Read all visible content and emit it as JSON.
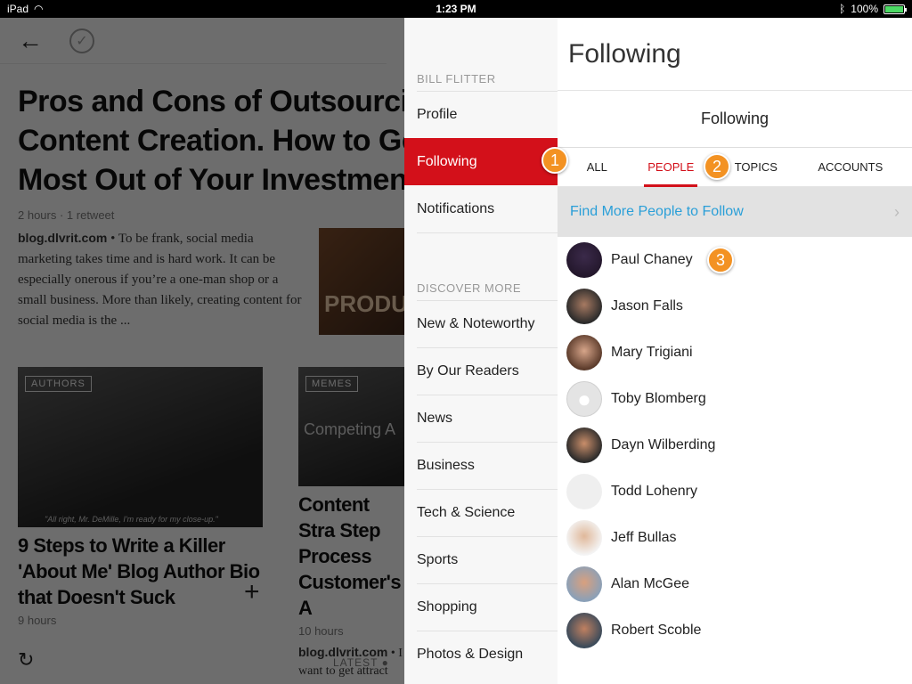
{
  "status_bar": {
    "device": "iPad",
    "time": "1:23 PM",
    "battery": "100%"
  },
  "article": {
    "headline": "Pros and Cons of Outsourcing Content Creation. How to Get the Most Out of Your Investment.",
    "meta": "2 hours · 1 retweet",
    "source": "blog.dlvrit.com",
    "excerpt": " • To be frank, social media marketing takes time and is hard work. It can be especially onerous if you’re a one-man shop or a small business. More than likely, creating content for social media is the ...",
    "thumb_text": "PRODU"
  },
  "cards": [
    {
      "tag": "AUTHORS",
      "caption": "\"All right, Mr. DeMille, I'm ready for my close-up.\"",
      "title": "9 Steps to Write a Killer 'About Me' Blog Author Bio that Doesn't Suck",
      "meta": "9 hours"
    },
    {
      "tag": "MEMES",
      "caption": "Competing A",
      "title": "Content Stra Step Process Customer's A",
      "meta": "10 hours",
      "source": "blog.dlvrit.com",
      "excerpt": " • I",
      "excerpt2": "want to get attract"
    }
  ],
  "bottom": {
    "latest": "LATEST"
  },
  "nav": {
    "user": "BILL FLITTER",
    "items": [
      "Profile",
      "Following",
      "Notifications"
    ],
    "discover_label": "DISCOVER MORE",
    "discover": [
      "New & Noteworthy",
      "By Our Readers",
      "News",
      "Business",
      "Tech & Science",
      "Sports",
      "Shopping",
      "Photos & Design"
    ]
  },
  "panel": {
    "title": "Following",
    "subtitle": "Following",
    "tabs": [
      "ALL",
      "PEOPLE",
      "TOPICS",
      "ACCOUNTS"
    ],
    "find_more": "Find More People to Follow",
    "people": [
      "Paul Chaney",
      "Jason Falls",
      "Mary Trigiani",
      "Toby Blomberg",
      "Dayn Wilberding",
      "Todd Lohenry",
      "Jeff Bullas",
      "Alan McGee",
      "Robert Scoble"
    ]
  },
  "callouts": [
    "1",
    "2",
    "3"
  ],
  "colors": {
    "accent": "#d3101a",
    "link": "#2a9fd8",
    "callout": "#f39223"
  }
}
